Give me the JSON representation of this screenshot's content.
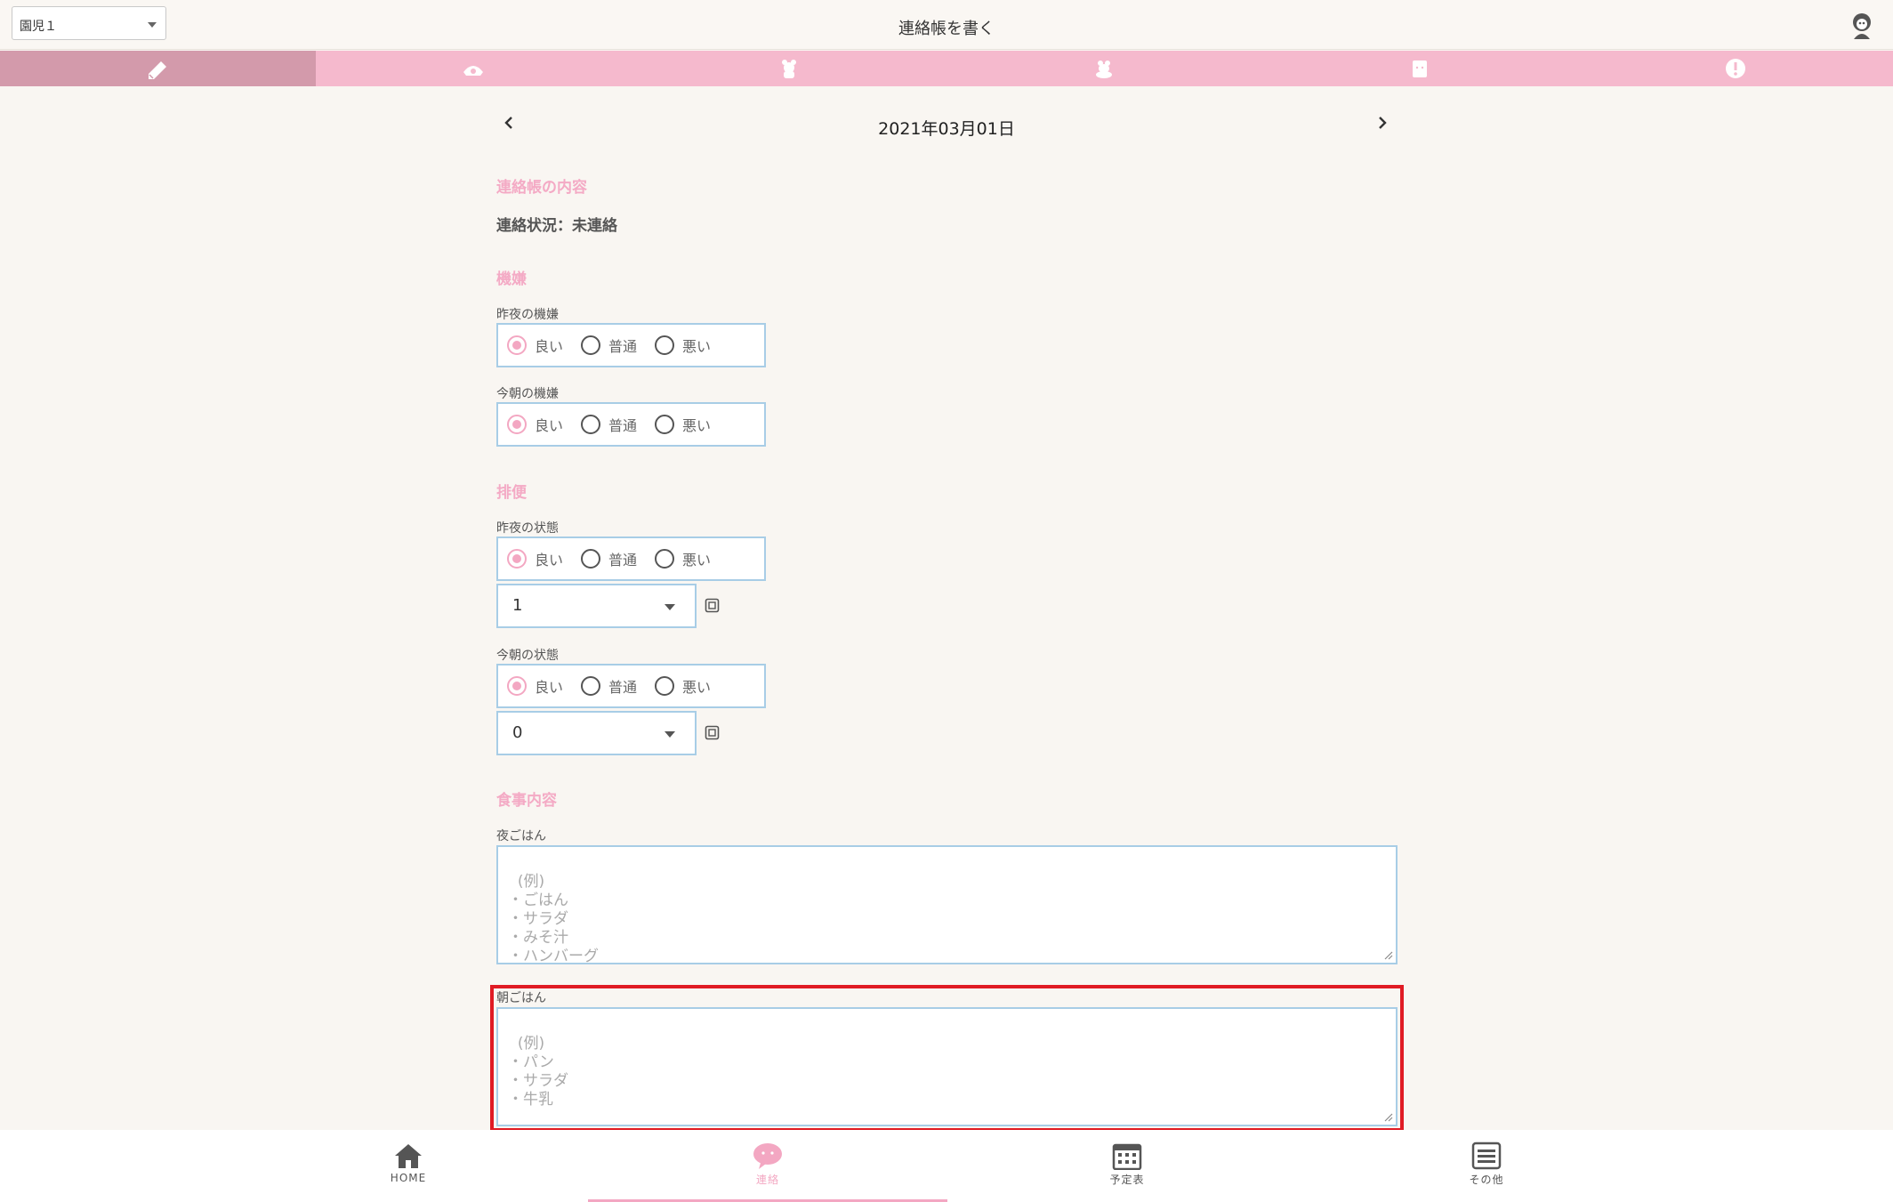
{
  "header": {
    "child_select": "園児１",
    "title": "連絡帳を書く"
  },
  "tabs": [
    {
      "icon": "pencil-icon",
      "active": true
    },
    {
      "icon": "phone-icon",
      "active": false
    },
    {
      "icon": "bear-icon",
      "active": false
    },
    {
      "icon": "bear-alt-icon",
      "active": false
    },
    {
      "icon": "calendar-face-icon",
      "active": false
    },
    {
      "icon": "alert-icon",
      "active": false
    }
  ],
  "date": "2021年03月01日",
  "sections": {
    "contact": {
      "title": "連絡帳の内容",
      "status": "連絡状況：未連絡"
    },
    "mood": {
      "title": "機嫌",
      "last_night_label": "昨夜の機嫌",
      "this_morning_label": "今朝の機嫌"
    },
    "bowel": {
      "title": "排便",
      "last_night_label": "昨夜の状態",
      "last_night_count": "1",
      "this_morning_label": "今朝の状態",
      "this_morning_count": "0"
    },
    "meal": {
      "title": "食事内容",
      "dinner_label": "夜ごはん",
      "dinner_placeholder": "(例)\n・ごはん\n・サラダ\n・みそ汁\n・ハンバーグ",
      "breakfast_label": "朝ごはん",
      "breakfast_placeholder": "(例)\n・パン\n・サラダ\n・牛乳"
    }
  },
  "radio_options": [
    "良い",
    "普通",
    "悪い"
  ],
  "selected_option": "良い",
  "bottom_nav": [
    {
      "label": "HOME",
      "icon": "home-icon",
      "active": false
    },
    {
      "label": "連絡",
      "icon": "chat-face-icon",
      "active": true
    },
    {
      "label": "予定表",
      "icon": "calendar-icon",
      "active": false
    },
    {
      "label": "その他",
      "icon": "menu-icon",
      "active": false
    }
  ],
  "colors": {
    "accent_pink": "#f5b9cd",
    "active_tab": "#d39aab",
    "input_border": "#a8cde6",
    "highlight": "#e01b24"
  }
}
